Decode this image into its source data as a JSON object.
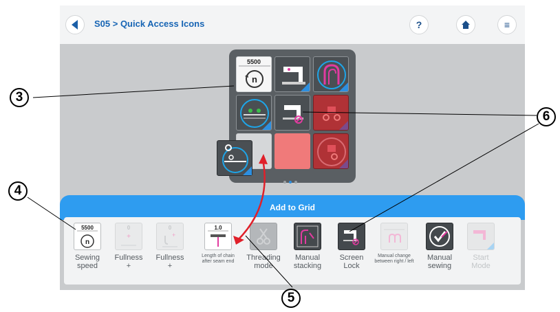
{
  "header": {
    "title": "S05 > Quick Access Icons",
    "help_label": "?",
    "menu_label": "≡"
  },
  "grid": {
    "speed_value": "5500",
    "page_indicator": {
      "count": 3,
      "active": 2
    }
  },
  "add_to_grid": {
    "label": "Add to Grid",
    "items": [
      {
        "num": "5500",
        "label_line1": "Sewing",
        "label_line2": "speed"
      },
      {
        "num": "0",
        "label_line1": "Fullness",
        "label_line2": "+"
      },
      {
        "num": "0",
        "label_line1": "Fullness",
        "label_line2": "+"
      },
      {
        "num": "1.0",
        "label": "Length of chain after seam end"
      },
      {
        "label_line1": "Threading",
        "label_line2": "mode"
      },
      {
        "label_line1": "Manual",
        "label_line2": "stacking"
      },
      {
        "label_line1": "Screen",
        "label_line2": "Lock"
      },
      {
        "label": "Manual change between right / left"
      },
      {
        "label_line1": "Manual",
        "label_line2": "sewing"
      },
      {
        "label_line1": "Start",
        "label_line2": "Mode"
      }
    ]
  },
  "callouts": [
    "3",
    "4",
    "5",
    "6"
  ],
  "colors": {
    "accent_blue": "#2e9cf0",
    "title_blue": "#1664b4",
    "arrow_red": "#e0202a",
    "magenta_icon": "#e23ba0",
    "cyan_icon": "#1ea5e8"
  },
  "icons": [
    "back-icon",
    "help-icon",
    "home-icon",
    "menu-icon",
    "counter-icon",
    "sewing-machine-icon",
    "thread-spool-icon",
    "fullness-icon",
    "screen-lock-icon",
    "checkmark-icon"
  ]
}
